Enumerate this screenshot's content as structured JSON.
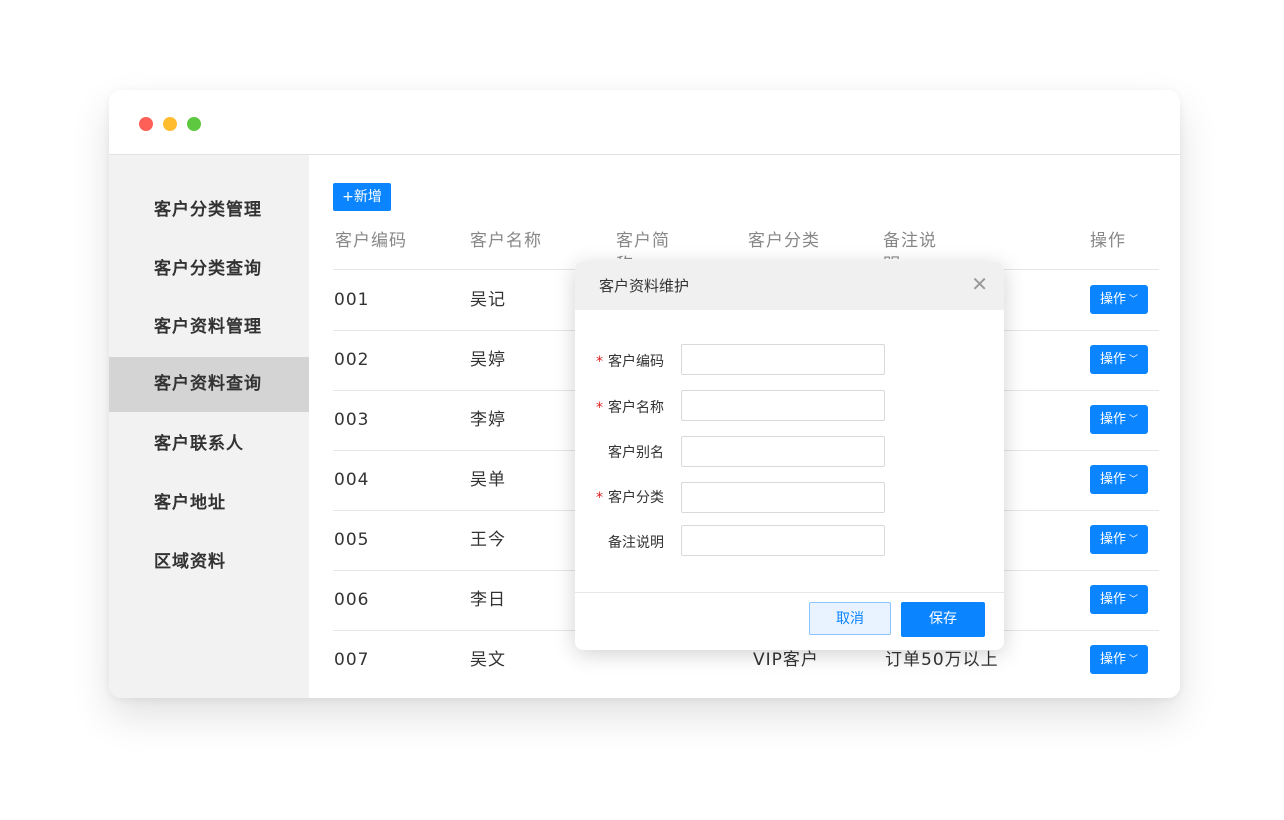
{
  "sidebar": {
    "items": [
      {
        "label": "客户分类管理"
      },
      {
        "label": "客户分类查询"
      },
      {
        "label": "客户资料管理"
      },
      {
        "label": "客户资料查询",
        "active": true
      },
      {
        "label": "客户联系人"
      },
      {
        "label": "客户地址"
      },
      {
        "label": "区域资料"
      }
    ]
  },
  "toolbar": {
    "add_label": "新增"
  },
  "table": {
    "columns": [
      "客户编码",
      "客户名称",
      "客户简称",
      "客户分类",
      "备注说明",
      "操作"
    ],
    "rows": [
      {
        "code": "001",
        "name": "吴记",
        "alias": "",
        "category": "",
        "remark": ""
      },
      {
        "code": "002",
        "name": "吴婷",
        "alias": "",
        "category": "",
        "remark": ""
      },
      {
        "code": "003",
        "name": "李婷",
        "alias": "",
        "category": "",
        "remark": ""
      },
      {
        "code": "004",
        "name": "吴单",
        "alias": "",
        "category": "",
        "remark": ""
      },
      {
        "code": "005",
        "name": "王今",
        "alias": "",
        "category": "",
        "remark": ""
      },
      {
        "code": "006",
        "name": "李日",
        "alias": "",
        "category": "",
        "remark": ""
      },
      {
        "code": "007",
        "name": "吴文",
        "alias": "",
        "category": "VIP客户",
        "remark": "订单50万以上"
      }
    ],
    "row_action_label": "操作"
  },
  "modal": {
    "title": "客户资料维护",
    "fields": [
      {
        "label": "客户编码",
        "required": true,
        "value": ""
      },
      {
        "label": "客户名称",
        "required": true,
        "value": ""
      },
      {
        "label": "客户别名",
        "required": false,
        "value": ""
      },
      {
        "label": "客户分类",
        "required": true,
        "value": ""
      },
      {
        "label": "备注说明",
        "required": false,
        "value": ""
      }
    ],
    "required_mark": "*",
    "cancel_label": "取消",
    "save_label": "保存"
  },
  "colors": {
    "accent": "#0a84ff",
    "required": "#e02020",
    "sidebar_bg": "#f2f2f2",
    "sidebar_active": "#d4d4d4"
  }
}
